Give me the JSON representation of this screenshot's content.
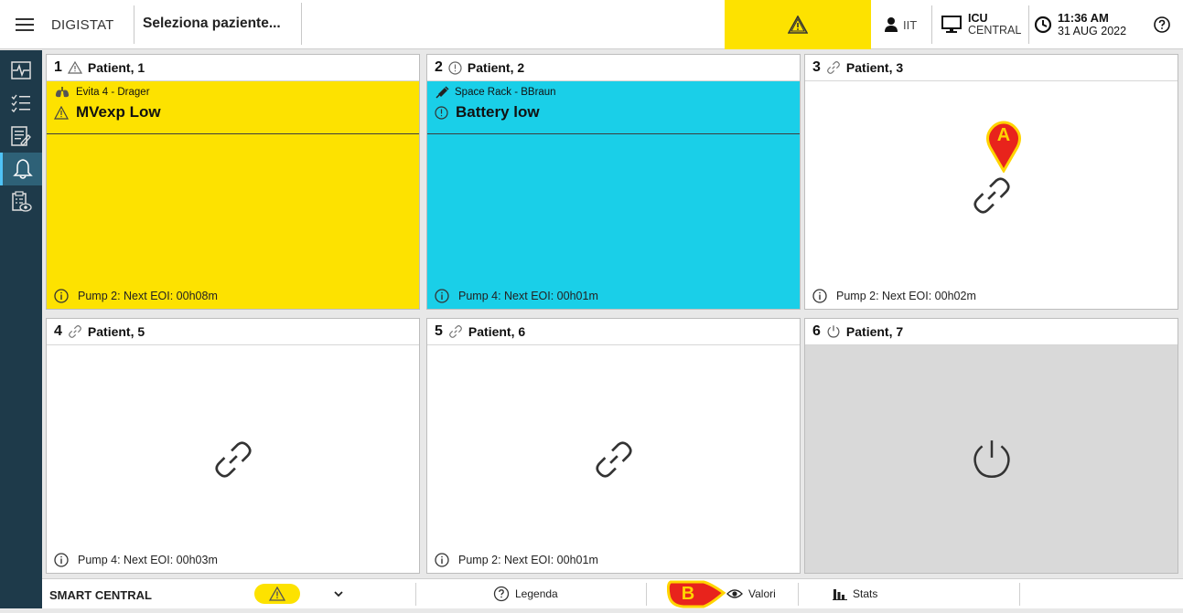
{
  "topbar": {
    "app_name": "DIGISTAT",
    "patient_placeholder": "Seleziona paziente...",
    "user": "IIT",
    "workstation_line1": "ICU",
    "workstation_line2": "CENTRAL",
    "time": "11:36 AM",
    "date": "31 AUG 2022"
  },
  "sidebar": {
    "items": [
      {
        "icon": "monitor-waveform-icon"
      },
      {
        "icon": "checklist-icon"
      },
      {
        "icon": "notes-icon"
      },
      {
        "icon": "bell-icon",
        "active": true
      },
      {
        "icon": "clipboard-eye-icon"
      }
    ]
  },
  "beds": [
    {
      "number": "1",
      "status_icon": "warning-icon",
      "name": "Patient, 1",
      "state": "alarm-yellow",
      "device": "Evita 4 - Drager",
      "alarm": "MVexp Low",
      "footer": "Pump 2: Next EOI: 00h08m"
    },
    {
      "number": "2",
      "status_icon": "info-circle-icon",
      "name": "Patient, 2",
      "state": "alarm-cyan",
      "device": "Space Rack - BBraun",
      "alarm": "Battery low",
      "footer": "Pump 4: Next EOI: 00h01m"
    },
    {
      "number": "3",
      "status_icon": "link-icon",
      "name": "Patient, 3",
      "state": "connected",
      "footer": "Pump 2: Next EOI: 00h02m"
    },
    {
      "number": "4",
      "status_icon": "link-icon",
      "name": "Patient, 5",
      "state": "connected",
      "footer": "Pump 4: Next EOI: 00h03m"
    },
    {
      "number": "5",
      "status_icon": "link-icon",
      "name": "Patient, 6",
      "state": "connected",
      "footer": "Pump 2: Next EOI: 00h01m"
    },
    {
      "number": "6",
      "status_icon": "power-icon",
      "name": "Patient, 7",
      "state": "off"
    }
  ],
  "callouts": {
    "a": "A",
    "b": "B"
  },
  "bottombar": {
    "title": "SMART CENTRAL",
    "legend_label": "Legenda",
    "values_label": "Valori",
    "stats_label": "Stats"
  },
  "colors": {
    "alarm_yellow": "#fde200",
    "alarm_cyan": "#1acfe8",
    "sidebar_bg": "#1e3a4a",
    "callout_red": "#e8231c",
    "off_grey": "#d9d9d9"
  }
}
